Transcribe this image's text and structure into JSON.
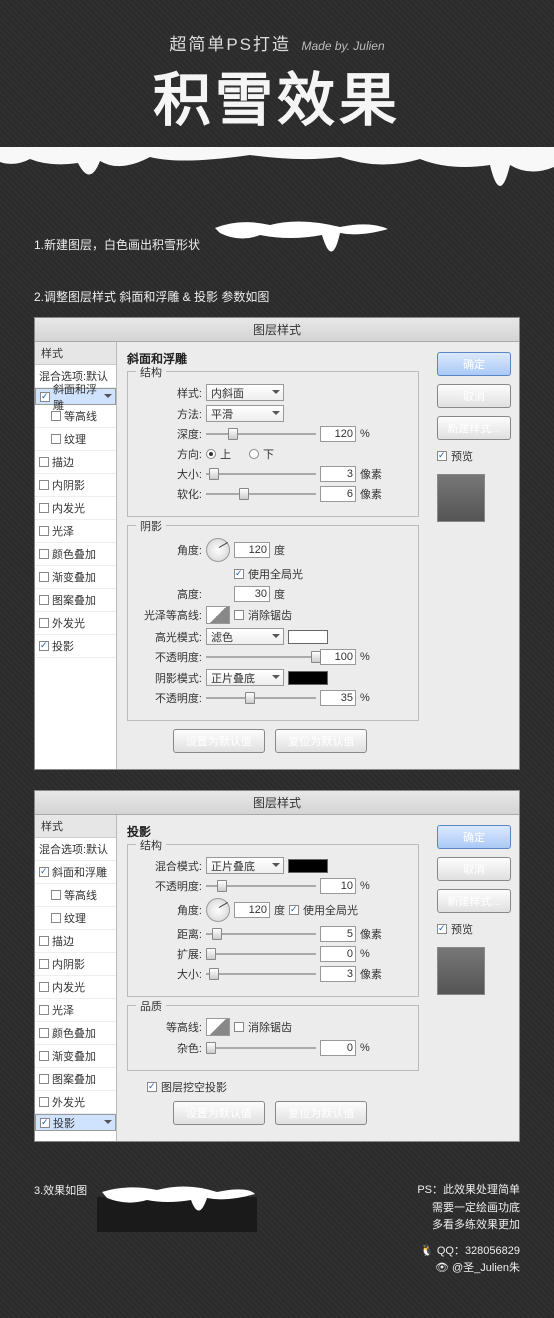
{
  "header": {
    "subtitle": "超简单PS打造",
    "madeby": "Made by. Julien",
    "title": "积雪效果"
  },
  "step1": "1.新建图层，白色画出积雪形状",
  "step2": "2.调整图层样式  斜面和浮雕  &  投影  参数如图",
  "step3": "3.效果如图",
  "dialog_title": "图层样式",
  "sidebar": {
    "header": "样式",
    "blend": "混合选项:默认",
    "items": [
      {
        "label": "斜面和浮雕",
        "checked": true,
        "selected": true,
        "indent": false
      },
      {
        "label": "等高线",
        "checked": false,
        "selected": false,
        "indent": true
      },
      {
        "label": "纹理",
        "checked": false,
        "selected": false,
        "indent": true
      },
      {
        "label": "描边",
        "checked": false,
        "selected": false,
        "indent": false
      },
      {
        "label": "内阴影",
        "checked": false,
        "selected": false,
        "indent": false
      },
      {
        "label": "内发光",
        "checked": false,
        "selected": false,
        "indent": false
      },
      {
        "label": "光泽",
        "checked": false,
        "selected": false,
        "indent": false
      },
      {
        "label": "颜色叠加",
        "checked": false,
        "selected": false,
        "indent": false
      },
      {
        "label": "渐变叠加",
        "checked": false,
        "selected": false,
        "indent": false
      },
      {
        "label": "图案叠加",
        "checked": false,
        "selected": false,
        "indent": false
      },
      {
        "label": "外发光",
        "checked": false,
        "selected": false,
        "indent": false
      },
      {
        "label": "投影",
        "checked": true,
        "selected": false,
        "indent": false
      }
    ]
  },
  "sidebar2_selected_index": 11,
  "buttons": {
    "ok": "确定",
    "cancel": "取消",
    "newstyle": "新建样式...",
    "preview": "预览"
  },
  "bevel": {
    "section": "斜面和浮雕",
    "struct_title": "结构",
    "style_label": "样式:",
    "style_value": "内斜面",
    "method_label": "方法:",
    "method_value": "平滑",
    "depth_label": "深度:",
    "depth_value": "120",
    "pct": "%",
    "dir_label": "方向:",
    "up": "上",
    "down": "下",
    "size_label": "大小:",
    "size_value": "3",
    "px": "像素",
    "soft_label": "软化:",
    "soft_value": "6",
    "shade_title": "阴影",
    "angle_label": "角度:",
    "angle_value": "120",
    "deg": "度",
    "global_label": "使用全局光",
    "alt_label": "高度:",
    "alt_value": "30",
    "gloss_label": "光泽等高线:",
    "antialias": "消除锯齿",
    "hl_mode_label": "高光模式:",
    "hl_mode_value": "滤色",
    "hl_op_label": "不透明度:",
    "hl_op_value": "100",
    "sh_mode_label": "阴影模式:",
    "sh_mode_value": "正片叠底",
    "sh_op_label": "不透明度:",
    "sh_op_value": "35"
  },
  "shadow": {
    "section": "投影",
    "struct_title": "结构",
    "blend_label": "混合模式:",
    "blend_value": "正片叠底",
    "op_label": "不透明度:",
    "op_value": "10",
    "angle_label": "角度:",
    "angle_value": "120",
    "deg": "度",
    "global": "使用全局光",
    "dist_label": "距离:",
    "dist_value": "5",
    "px": "像素",
    "spread_label": "扩展:",
    "spread_value": "0",
    "pct": "%",
    "size_label": "大小:",
    "size_value": "3",
    "quality_title": "品质",
    "contour_label": "等高线:",
    "antialias": "消除锯齿",
    "noise_label": "杂色:",
    "noise_value": "0",
    "knockout": "图层挖空投影"
  },
  "bottom_buttons": {
    "set_default": "设置为默认值",
    "reset_default": "复位为默认值"
  },
  "footer": {
    "note1": "PS：此效果处理简单",
    "note2": "需要一定绘画功底",
    "note3": "多看多练效果更加",
    "qq_label": "QQ：",
    "qq": "328056829",
    "weibo_label": "@圣_Julien朱"
  }
}
